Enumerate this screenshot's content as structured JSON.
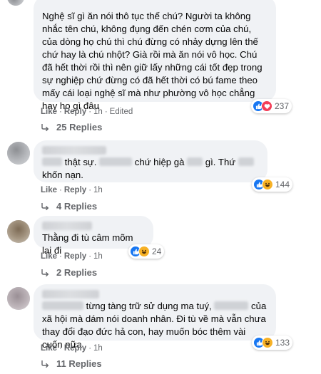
{
  "colors": {
    "bubble": "#f0f2f5",
    "meta": "#65676b",
    "like": "#1877f2",
    "love": "#f33e58",
    "haha": "#f7b125"
  },
  "comments": [
    {
      "text": "Nghệ sĩ gì ăn nói thô tục thế chú? Người ta không nhắc tên chú, không đụng đến chén cơm của chú, của dòng họ chú thì chú đừng có nhảy dựng lên thế chứ hay là chú nhột? Già rồi mà ăn nói vô học. Chú đã hết thời rồi thì nên giữ lấy những cái tốt đẹp trong sự nghiệp chứ đừng có đã hết thời có bú fame theo mấy cái loại nghệ sĩ mà như phường vô học chẳng hay ho gì đâu",
      "like": "Like",
      "reply": "Reply",
      "time": "1h",
      "edited": "Edited",
      "reactions": [
        "like-icon",
        "love-icon"
      ],
      "count": "237",
      "replies": "25 Replies"
    },
    {
      "text_parts": [
        "thật sự.",
        "chứ hiệp gà",
        "gì. Thứ",
        "khốn nạn."
      ],
      "like": "Like",
      "reply": "Reply",
      "time": "1h",
      "reactions": [
        "like-icon",
        "haha-icon"
      ],
      "count": "144",
      "replies": "4 Replies"
    },
    {
      "text": "Thằng đi tù câm mõm lại đi",
      "like": "Like",
      "reply": "Reply",
      "time": "1h",
      "reactions": [
        "like-icon",
        "haha-icon"
      ],
      "count": "24",
      "replies": "2 Replies"
    },
    {
      "text_parts": [
        "từng tàng trữ sử dụng ma tuý,",
        "của xã hội mà dám nói doanh nhân. Đi tù về mà vẫn chưa thay đổi đạo đức hả con, hay muốn bóc thêm vài cuốn nữa"
      ],
      "like": "Like",
      "reply": "Reply",
      "time": "1h",
      "reactions": [
        "like-icon",
        "haha-icon"
      ],
      "count": "133",
      "replies": "11 Replies"
    }
  ]
}
